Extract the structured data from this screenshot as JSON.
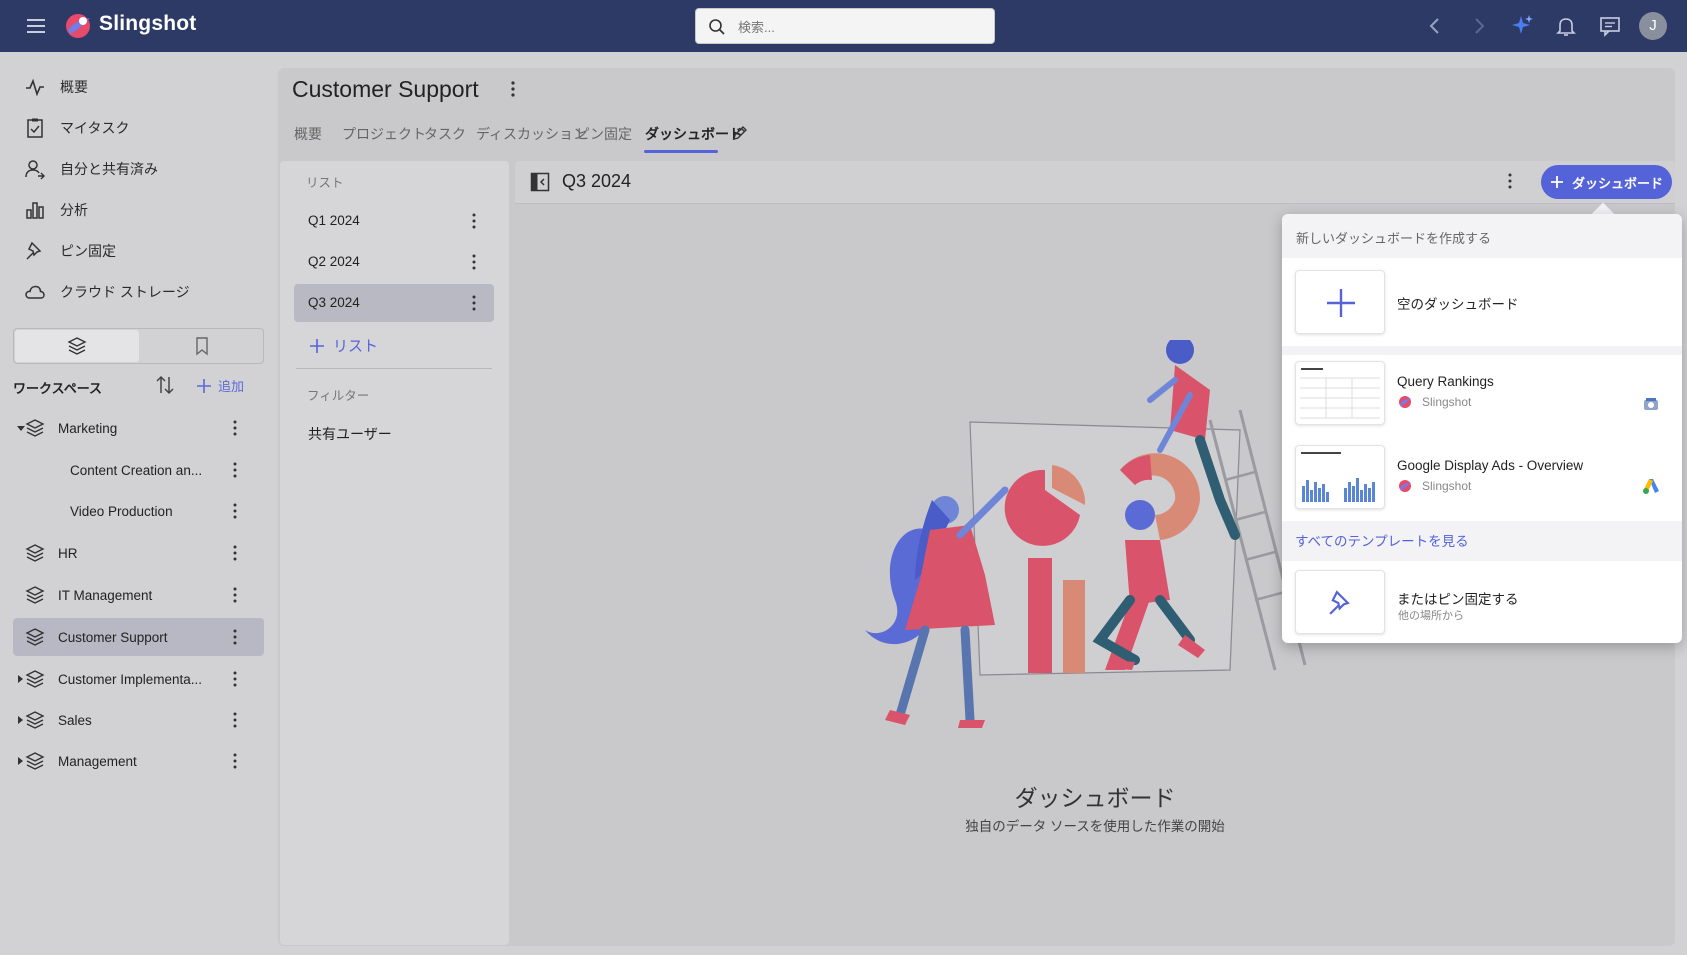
{
  "app": {
    "brand": "Slingshot",
    "search_placeholder": "検索...",
    "avatar_initial": "J"
  },
  "nav": {
    "items": [
      {
        "label": "概要",
        "icon": "activity-icon"
      },
      {
        "label": "マイタスク",
        "icon": "clipboard-check-icon"
      },
      {
        "label": "自分と共有済み",
        "icon": "shared-user-icon"
      },
      {
        "label": "分析",
        "icon": "bar-chart-icon"
      },
      {
        "label": "ピン固定",
        "icon": "pin-icon"
      },
      {
        "label": "クラウド ストレージ",
        "icon": "cloud-icon"
      }
    ]
  },
  "workspace": {
    "title": "ワークスペース",
    "add_label": "追加",
    "items": [
      {
        "label": "Marketing",
        "expanded": true
      },
      {
        "label": "Content Creation an...",
        "child": true
      },
      {
        "label": "Video Production",
        "child": true
      },
      {
        "label": "HR"
      },
      {
        "label": "IT Management"
      },
      {
        "label": "Customer Support",
        "selected": true
      },
      {
        "label": "Customer Implementa...",
        "collapsed": true
      },
      {
        "label": "Sales",
        "collapsed": true
      },
      {
        "label": "Management",
        "collapsed": true
      }
    ]
  },
  "page": {
    "title": "Customer Support",
    "tabs": [
      "概要",
      "プロジェクト",
      "タスク",
      "ディスカッション",
      "ピン固定",
      "ダッシュボード"
    ],
    "active_tab": "ダッシュボード"
  },
  "lists": {
    "header": "リスト",
    "items": [
      "Q1 2024",
      "Q2 2024",
      "Q3 2024"
    ],
    "selected": "Q3 2024",
    "add_label": "リスト",
    "filter_header": "フィルター",
    "filter_item": "共有ユーザー"
  },
  "content": {
    "title": "Q3 2024",
    "new_button": "ダッシュボード",
    "empty_title": "ダッシュボード",
    "empty_subtitle": "独自のデータ ソースを使用した作業の開始"
  },
  "popup": {
    "header": "新しいダッシュボードを作成する",
    "blank_label": "空のダッシュボード",
    "templates": [
      {
        "title": "Query Rankings",
        "source": "Slingshot",
        "datasource_icon": "google-search-console-icon"
      },
      {
        "title": "Google Display Ads - Overview",
        "source": "Slingshot",
        "datasource_icon": "google-ads-icon"
      }
    ],
    "see_all": "すべてのテンプレートを見る",
    "pin_title": "またはピン固定する",
    "pin_subtitle": "他の場所から"
  },
  "colors": {
    "topbar": "#2e3a66",
    "accent": "#5563d8",
    "selected": "#b7b8c3"
  }
}
